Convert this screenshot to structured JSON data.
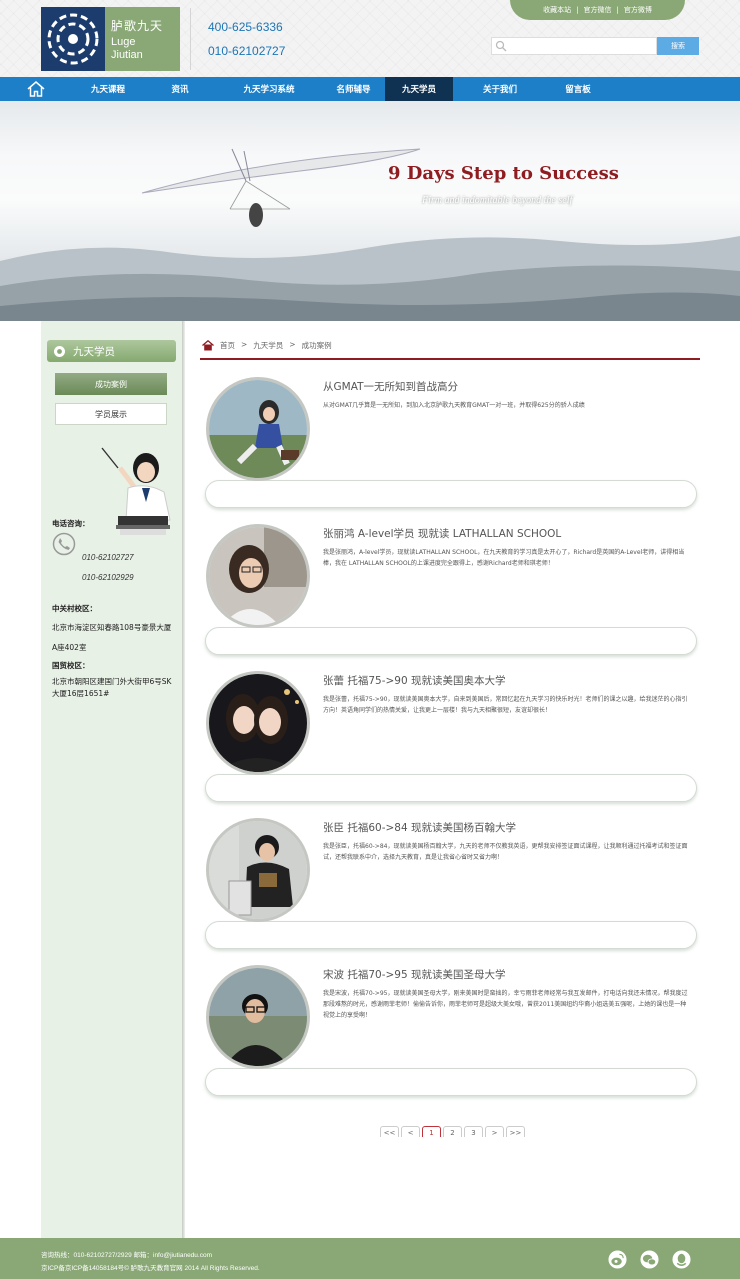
{
  "header": {
    "logo": {
      "cn": "胪歌九天",
      "en_line1": "Luge",
      "en_line2": "Jiutian"
    },
    "phone1": "400-625-6336",
    "phone2": "010-62102727",
    "top_links": [
      "收藏本站",
      "官方微信",
      "官方微博"
    ],
    "top_links_separator": "|",
    "search": {
      "placeholder": "",
      "button": "搜索"
    }
  },
  "nav": {
    "home_icon": "home-icon",
    "items": [
      "九天课程",
      "资讯",
      "九天学习系统",
      "名师辅导",
      "九天学员",
      "关于我们",
      "留言板"
    ],
    "active": "九天学员"
  },
  "banner": {
    "title": "9 Days Step to Success",
    "subtitle": "Firm and indomitable beyond the self"
  },
  "sidebar": {
    "title": "九天学员",
    "title_icon": "gear-icon",
    "buttons": [
      "成功案例",
      "学员展示"
    ],
    "active_button": "成功案例",
    "phone_label": "电话咨询：",
    "phone_icon": "phone-icon",
    "phones": [
      "010-62102727",
      "010-62102929"
    ],
    "campus1_label": "中关村校区：",
    "campus1_line1": "北京市海淀区知春路108号豪景大厦",
    "campus1_line2": "A座402室",
    "campus2_label": "国贸校区：",
    "campus2_line1": "北京市朝阳区建国门外大街甲6号SK",
    "campus2_line2": "大厦16层1651#"
  },
  "breadcrumb": {
    "icon": "home-icon",
    "items": [
      "首页",
      "九天学员",
      "成功案例"
    ],
    "separator": ">"
  },
  "cases": [
    {
      "title": "从GMAT一无所知到首战高分",
      "text": "从对GMAT几乎算是一无所知，到加入北京胪歌九天教育GMAT一对一班，并取得625分的骄人成绩"
    },
    {
      "title": "张丽鸿 A-level学员 现就读 LATHALLAN SCHOOL",
      "text": "我是张丽鸿，A-level学员，现就读LATHALLAN SCHOOL，在九天教育的学习真是太开心了，Richard是英国的A-Level老师，讲得相当棒，我在 LATHALLAN SCHOOL的上课进度完全跟得上，感谢Richard老师和琪老师！"
    },
    {
      "title": "张蕾 托福75->90 现就读美国奥本大学",
      "text": "我是张蕾，托福75->90，现就读美国奥本大学，自来到美国后，常回忆起在九天学习的快乐时光！老师们的课之以趣，给我迷茫的心指引方向！英语角同学们的热情关爱，让我更上一层楼！我与九天相聚很短，友谊却很长！"
    },
    {
      "title": "张臣 托福60->84 现就读美国杨百翰大学",
      "text": "我是张臣，托福60->84，现就读美国杨百翰大学，九天的老师不仅教我英语，更帮我安排签证面试课程，让我顺利通过托福考试和签证面试，还帮我联系中介，选择九天教育，真是让我省心省时又省力啊！"
    },
    {
      "title": "宋波 托福70->95 现就读美国圣母大学",
      "text": "我是宋波，托福70->95，现就读美国圣母大学，刚来美国时是蛮拙的，幸亏雨菲老师经常与我互发邮件，打电话向我还未情况，帮我度过那段难熬的时光，感谢雨菲老师！偷偷告诉你，雨菲老师可是超级大美女哦，曾获2011美国纽约华裔小姐选美五强呢，上她的课也是一种视觉上的享受啊！"
    }
  ],
  "pager": {
    "items": [
      "<<",
      "<",
      "1",
      "2",
      "3",
      ">",
      ">>"
    ],
    "current": "1"
  },
  "footer": {
    "line1": "咨询热线：010-62102727/2929 邮箱：info@jiutianedu.com",
    "line2": "京ICP备京ICP备14058184号© 胪歌九天教育官网 2014 All Rights Reserved.",
    "icons": [
      "weibo-icon",
      "wechat-icon",
      "qq-icon"
    ]
  },
  "colors": {
    "nav_blue": "#1c7fc8",
    "nav_active": "#0f3152",
    "green": "#8aa876",
    "accent_red": "#8e1c20"
  }
}
